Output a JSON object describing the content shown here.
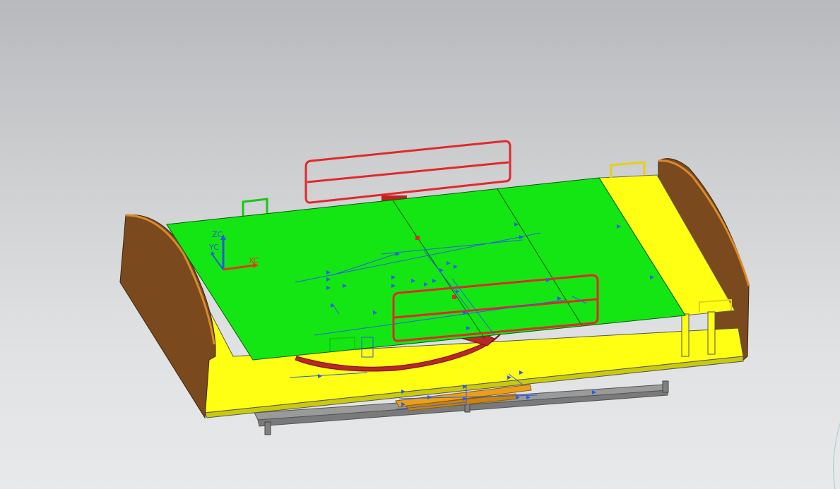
{
  "triad": {
    "z_label": "ZC",
    "y_label": "YC",
    "x_label": "XC"
  },
  "colors": {
    "background_top": "#b7b9bc",
    "background_bottom": "#e8e9ea",
    "deck_green": "#14e614",
    "frame_yellow": "#ffff14",
    "headboard_brown": "#7a4a1e",
    "rail_red": "#e0292a",
    "arc_red": "#b8272a",
    "base_gray": "#8c8c8c",
    "constraint_blue": "#2e5be6",
    "triad_blue": "#2a56e0",
    "triad_red": "#e03a1a"
  },
  "icons": {
    "triad": "wcs-triad-icon",
    "constraint_marker": "dimension-constraint-icon"
  }
}
